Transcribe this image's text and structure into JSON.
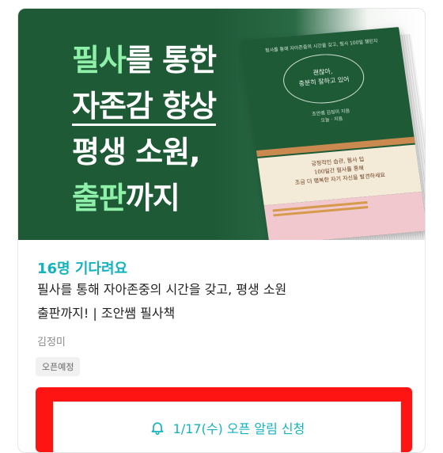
{
  "banner": {
    "headline_line1_accent": "필사",
    "headline_line1_rest": "를 통한",
    "headline_line2": "자존감 향상",
    "headline_line3": "평생 소원,",
    "headline_line4_accent": "출판",
    "headline_line4_rest": "까지"
  },
  "book": {
    "top_text": "필사를 통해 자아존중의 시간을 갖고, 필사 100일 챌린지",
    "cover_title_line1": "괜찮아,",
    "cover_title_line2": "충분히 잘하고 있어",
    "author_line1": "조안쌤 김정미 지음",
    "author_line2": "오늘 · 지음",
    "band_title": "긍정적인 습관, 필사 입",
    "band_line2": "100일간 필사를 통해",
    "band_line3": "조금 더 행복한 자기 자신을 발견하세요"
  },
  "card": {
    "waiting_text": "16명 기다려요",
    "title_line1": "필사를 통해 자아존중의 시간을 갖고, 평생 소원",
    "title_line2": "출판까지! | 조안쌤 필사책",
    "author": "김정미",
    "badge": "오픈예정",
    "alert_button_label": "1/17(수) 오픈 알림 신청"
  },
  "colors": {
    "accent_teal": "#12b3bd",
    "banner_green": "#1f5a37",
    "headline_accent": "#8ef0a9",
    "highlight_red": "#ff1414"
  },
  "icons": {
    "alert_button_icon": "bell-icon"
  }
}
